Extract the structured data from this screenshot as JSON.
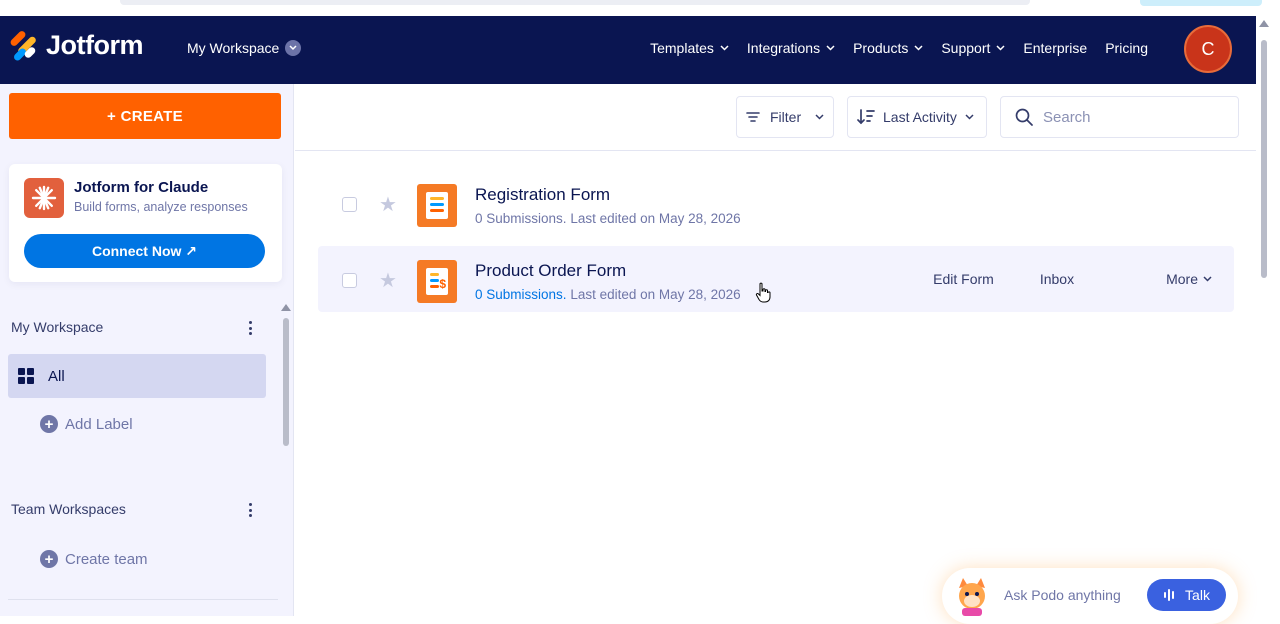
{
  "brand": {
    "name": "Jotform",
    "accent": "#ff6100",
    "nav_bg": "#0a1551"
  },
  "nav": {
    "workspace_label": "My Workspace",
    "menu": [
      "Templates",
      "Integrations",
      "Products",
      "Support",
      "Enterprise",
      "Pricing"
    ],
    "avatar_initial": "C"
  },
  "sidebar": {
    "create_label": "+ CREATE",
    "promo": {
      "title": "Jotform for Claude",
      "subtitle": "Build forms, analyze responses",
      "button_label": "Connect Now ↗"
    },
    "my_workspace_title": "My Workspace",
    "all_label": "All",
    "add_label": "Add Label",
    "team_title": "Team Workspaces",
    "create_team": "Create team"
  },
  "toolbar": {
    "filter_label": "Filter",
    "sort_label": "Last Activity",
    "search_placeholder": "Search"
  },
  "forms": [
    {
      "title": "Registration Form",
      "submissions": "0 Submissions.",
      "edited": "Last edited on May 28, 2026"
    },
    {
      "title": "Product Order Form",
      "submissions": "0 Submissions.",
      "edited": "Last edited on May 28, 2026"
    }
  ],
  "row_actions": {
    "edit": "Edit Form",
    "inbox": "Inbox",
    "more": "More"
  },
  "podo": {
    "prompt": "Ask Podo anything",
    "talk_label": "Talk"
  },
  "icons": {
    "search": "search-icon",
    "filter": "filter-icon",
    "sort": "sort-icon",
    "star": "star-icon",
    "form": "form-icon"
  }
}
